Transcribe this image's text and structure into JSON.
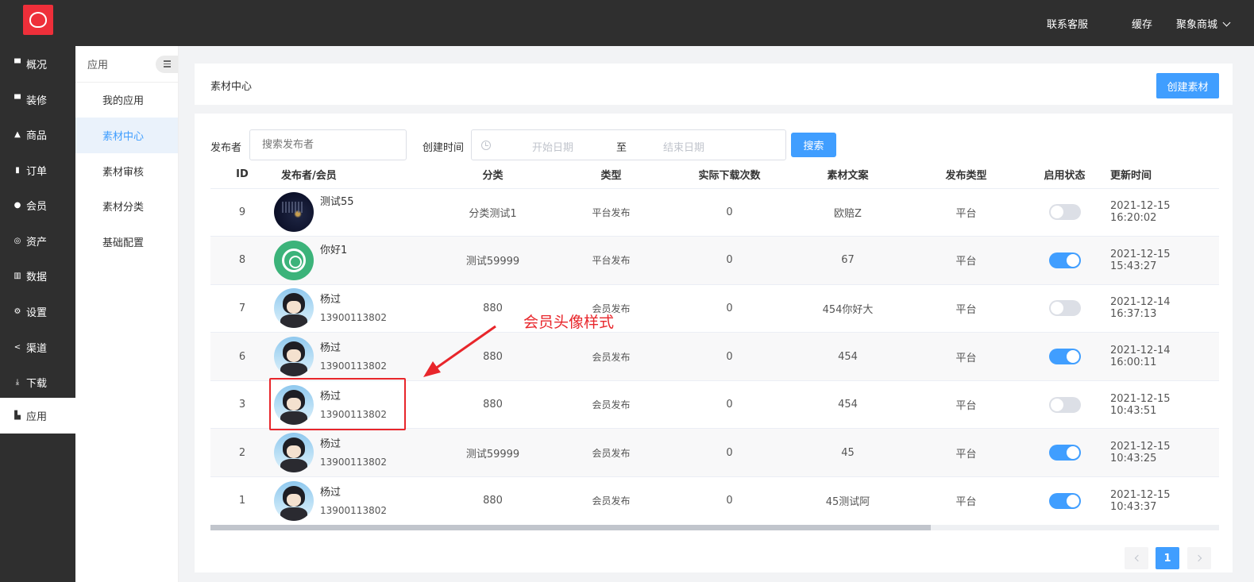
{
  "top_nav": {
    "links": [
      "联系客服",
      "缓存",
      "聚象商城"
    ]
  },
  "side_nav": {
    "items": [
      {
        "label": "概况",
        "icon": "monitor-icon"
      },
      {
        "label": "装修",
        "icon": "monitor-icon"
      },
      {
        "label": "商品",
        "icon": "bag-icon"
      },
      {
        "label": "订单",
        "icon": "clipboard-icon"
      },
      {
        "label": "会员",
        "icon": "user-icon"
      },
      {
        "label": "资产",
        "icon": "database-icon"
      },
      {
        "label": "数据",
        "icon": "bar-chart-icon"
      },
      {
        "label": "设置",
        "icon": "gear-icon"
      },
      {
        "label": "渠道",
        "icon": "share-icon"
      },
      {
        "label": "下载",
        "icon": "download-icon"
      },
      {
        "label": "应用",
        "icon": "app-icon",
        "active": true
      }
    ]
  },
  "sub_nav": {
    "title": "应用",
    "items": [
      {
        "label": "我的应用"
      },
      {
        "label": "素材中心",
        "active": true
      },
      {
        "label": "素材审核"
      },
      {
        "label": "素材分类"
      },
      {
        "label": "基础配置"
      }
    ]
  },
  "header": {
    "title": "素材中心",
    "create_label": "创建素材"
  },
  "filters": {
    "publisher_label": "发布者",
    "publisher_placeholder": "搜索发布者",
    "time_label": "创建时间",
    "start_placeholder": "开始日期",
    "separator": "至",
    "end_placeholder": "结束日期",
    "search_label": "搜索"
  },
  "table": {
    "columns": [
      "ID",
      "发布者/会员",
      "分类",
      "类型",
      "实际下载次数",
      "素材文案",
      "发布类型",
      "启用状态",
      "更新时间"
    ],
    "rows": [
      {
        "id": "9",
        "name": "测试55",
        "phone": "",
        "avatar": "night",
        "category": "分类测试1",
        "type": "平台发布",
        "downloads": "0",
        "copy": "欧赔Z",
        "pub_type": "平台",
        "enabled": false,
        "updated": "2021-12-15 16:20:02"
      },
      {
        "id": "8",
        "name": "你好1",
        "phone": "",
        "avatar": "green",
        "category": "测试59999",
        "type": "平台发布",
        "downloads": "0",
        "copy": "67",
        "pub_type": "平台",
        "enabled": true,
        "updated": "2021-12-15 15:43:27"
      },
      {
        "id": "7",
        "name": "杨过",
        "phone": "13900113802",
        "avatar": "anime",
        "category": "880",
        "type": "会员发布",
        "downloads": "0",
        "copy": "454你好大",
        "pub_type": "平台",
        "enabled": false,
        "updated": "2021-12-14 16:37:13"
      },
      {
        "id": "6",
        "name": "杨过",
        "phone": "13900113802",
        "avatar": "anime",
        "category": "880",
        "type": "会员发布",
        "downloads": "0",
        "copy": "454",
        "pub_type": "平台",
        "enabled": true,
        "updated": "2021-12-14 16:00:11"
      },
      {
        "id": "3",
        "name": "杨过",
        "phone": "13900113802",
        "avatar": "anime",
        "category": "880",
        "type": "会员发布",
        "downloads": "0",
        "copy": "454",
        "pub_type": "平台",
        "enabled": false,
        "updated": "2021-12-15 10:43:51"
      },
      {
        "id": "2",
        "name": "杨过",
        "phone": "13900113802",
        "avatar": "anime",
        "category": "测试59999",
        "type": "会员发布",
        "downloads": "0",
        "copy": "45",
        "pub_type": "平台",
        "enabled": true,
        "updated": "2021-12-15 10:43:25"
      },
      {
        "id": "1",
        "name": "杨过",
        "phone": "13900113802",
        "avatar": "anime",
        "category": "880",
        "type": "会员发布",
        "downloads": "0",
        "copy": "45测试阿",
        "pub_type": "平台",
        "enabled": true,
        "updated": "2021-12-15 10:43:37"
      }
    ]
  },
  "pagination": {
    "current": "1"
  },
  "annotation": {
    "text": "会员头像样式"
  },
  "colors": {
    "primary": "#409eff",
    "dark_nav": "#2f2f2f",
    "logo_red": "#ee2f3a",
    "annotation_red": "#e8262b"
  }
}
